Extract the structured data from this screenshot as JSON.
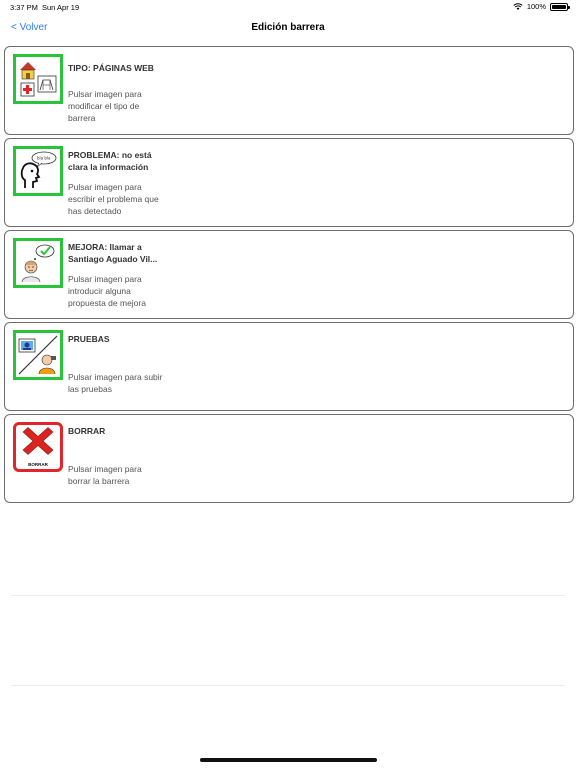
{
  "status_bar": {
    "time": "3:37 PM",
    "date": "Sun Apr 19",
    "battery": "100%"
  },
  "nav": {
    "back_label": "< Volver",
    "title": "Edición barrera"
  },
  "cards": [
    {
      "icon": "house-hospital-park-pictogram-icon",
      "title": "TIPO: PÁGINAS WEB",
      "description": "Pulsar imagen para\nmodificar el tipo de\nbarrera"
    },
    {
      "icon": "speaking-head-pictogram-icon",
      "title": "PROBLEMA: no está\nclara la información",
      "description": "Pulsar imagen para\nescribir el problema que\nhas detectado"
    },
    {
      "icon": "person-idea-check-pictogram-icon",
      "title": "MEJORA: llamar a\nSantiago Aguado Vil...",
      "description": "Pulsar imagen para\nintroducir alguna\npropuesta de mejora"
    },
    {
      "icon": "photos-evidence-pictogram-icon",
      "title": "PRUEBAS",
      "description": "Pulsar imagen para subir\nlas pruebas"
    },
    {
      "icon": "delete-x-icon",
      "title": "BORRAR",
      "description": "Pulsar imagen para\nborrar la barrera",
      "icon_caption": "BORRAR"
    }
  ],
  "colors": {
    "accent": "#2f7cf6",
    "icon_border_green": "#2ac43a",
    "icon_border_red": "#e0262a",
    "card_border": "#6e6e6e"
  }
}
